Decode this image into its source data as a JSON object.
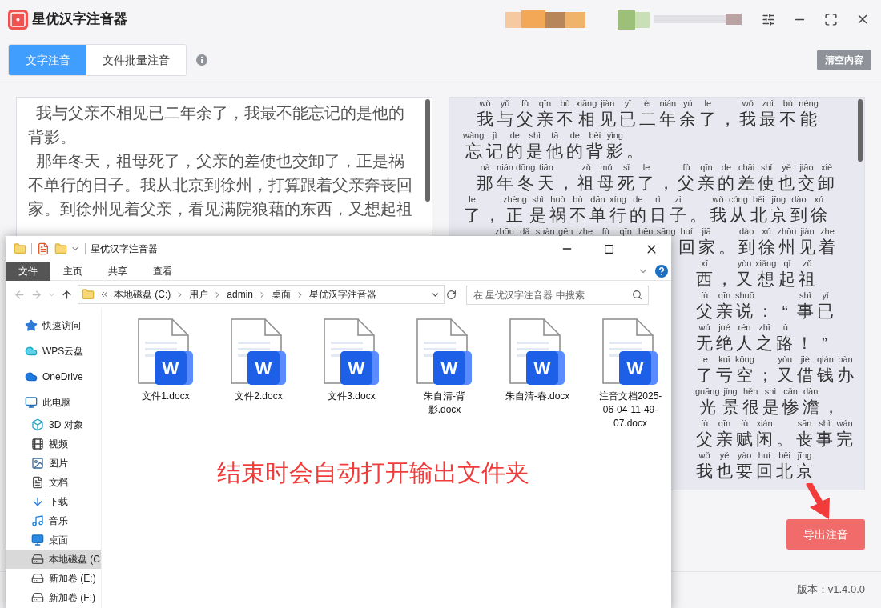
{
  "app": {
    "title": "星优汉字注音器",
    "tabs": [
      {
        "label": "文字注音",
        "selected": true
      },
      {
        "label": "文件批量注音",
        "selected": false
      }
    ],
    "clear_button": "清空内容",
    "input_paragraphs": [
      "我与父亲不相见已二年余了，我最不能忘记的是他的背影。",
      "那年冬天，祖母死了，父亲的差使也交卸了，正是祸不单行的日子。我从北京到徐州，打算跟着父亲奔丧回家。到徐州见着父亲，看见满院狼藉的东西，又想起祖"
    ],
    "pinyin_rows": [
      {
        "kind": "first",
        "tokens": [
          {
            "pinyin": "wǒ",
            "char": "我"
          },
          {
            "pinyin": "yǔ",
            "char": "与"
          },
          {
            "pinyin": "fù",
            "char": "父"
          },
          {
            "pinyin": "qīn",
            "char": "亲"
          },
          {
            "pinyin": "bù",
            "char": "不"
          },
          {
            "pinyin": "xiāng",
            "char": "相"
          },
          {
            "pinyin": "jiàn",
            "char": "见"
          },
          {
            "pinyin": "yǐ",
            "char": "已"
          },
          {
            "pinyin": "èr",
            "char": "二"
          },
          {
            "pinyin": "nián",
            "char": "年"
          },
          {
            "pinyin": "yú",
            "char": "余"
          },
          {
            "pinyin": "le",
            "char": "了"
          },
          {
            "char": "，"
          },
          {
            "pinyin": "wǒ",
            "char": "我"
          },
          {
            "pinyin": "zuì",
            "char": "最"
          },
          {
            "pinyin": "bù",
            "char": "不"
          },
          {
            "pinyin": "néng",
            "char": "能"
          }
        ]
      },
      {
        "kind": "line",
        "tokens": [
          {
            "pinyin": "wàng",
            "char": "忘"
          },
          {
            "pinyin": "jì",
            "char": "记"
          },
          {
            "pinyin": "de",
            "char": "的"
          },
          {
            "pinyin": "shì",
            "char": "是"
          },
          {
            "pinyin": "tā",
            "char": "他"
          },
          {
            "pinyin": "de",
            "char": "的"
          },
          {
            "pinyin": "bèi",
            "char": "背"
          },
          {
            "pinyin": "yǐng",
            "char": "影"
          },
          {
            "char": "。"
          }
        ]
      },
      {
        "kind": "first",
        "tokens": [
          {
            "pinyin": "nà",
            "char": "那"
          },
          {
            "pinyin": "nián",
            "char": "年"
          },
          {
            "pinyin": "dōng",
            "char": "冬"
          },
          {
            "pinyin": "tiān",
            "char": "天"
          },
          {
            "char": "，"
          },
          {
            "pinyin": "zǔ",
            "char": "祖"
          },
          {
            "pinyin": "mǔ",
            "char": "母"
          },
          {
            "pinyin": "sǐ",
            "char": "死"
          },
          {
            "pinyin": "le",
            "char": "了"
          },
          {
            "char": "，"
          },
          {
            "pinyin": "fù",
            "char": "父"
          },
          {
            "pinyin": "qīn",
            "char": "亲"
          },
          {
            "pinyin": "de",
            "char": "的"
          },
          {
            "pinyin": "chāi",
            "char": "差"
          },
          {
            "pinyin": "shǐ",
            "char": "使"
          },
          {
            "pinyin": "yě",
            "char": "也"
          },
          {
            "pinyin": "jiāo",
            "char": "交"
          },
          {
            "pinyin": "xiè",
            "char": "卸"
          }
        ]
      },
      {
        "kind": "line",
        "tokens": [
          {
            "pinyin": "le",
            "char": "了"
          },
          {
            "char": "，"
          },
          {
            "pinyin": "zhèng",
            "char": "正"
          },
          {
            "pinyin": "shì",
            "char": "是"
          },
          {
            "pinyin": "huò",
            "char": "祸"
          },
          {
            "pinyin": "bù",
            "char": "不"
          },
          {
            "pinyin": "dān",
            "char": "单"
          },
          {
            "pinyin": "xíng",
            "char": "行"
          },
          {
            "pinyin": "de",
            "char": "的"
          },
          {
            "pinyin": "rì",
            "char": "日"
          },
          {
            "pinyin": "zi",
            "char": "子"
          },
          {
            "char": "。"
          },
          {
            "pinyin": "wǒ",
            "char": "我"
          },
          {
            "pinyin": "cóng",
            "char": "从"
          },
          {
            "pinyin": "běi",
            "char": "北"
          },
          {
            "pinyin": "jīng",
            "char": "京"
          },
          {
            "pinyin": "dào",
            "char": "到"
          },
          {
            "pinyin": "xú",
            "char": "徐"
          }
        ]
      },
      {
        "kind": "partial",
        "tokens": [
          {
            "pinyin": "zhōu"
          },
          {
            "pinyin": "dǎ"
          },
          {
            "pinyin": "suàn"
          },
          {
            "pinyin": "gēn"
          },
          {
            "pinyin": "zhe"
          },
          {
            "pinyin": "fù"
          },
          {
            "pinyin": "qīn"
          },
          {
            "pinyin": "bēn"
          },
          {
            "pinyin": "sāng"
          },
          {
            "pinyin": "huí",
            "char": "回"
          },
          {
            "pinyin": "jiā",
            "char": "家"
          },
          {
            "char": "。"
          },
          {
            "pinyin": "dào",
            "char": "到"
          },
          {
            "pinyin": "xú",
            "char": "徐"
          },
          {
            "pinyin": "zhōu",
            "char": "州"
          },
          {
            "pinyin": "jiàn",
            "char": "见"
          },
          {
            "pinyin": "zhe",
            "char": "着"
          }
        ]
      },
      {
        "kind": "clipped",
        "tokens": [
          {
            "pinyin": "xī",
            "char": "西"
          },
          {
            "char": "，"
          },
          {
            "pinyin": "yòu",
            "char": "又"
          },
          {
            "pinyin": "xiǎng",
            "char": "想"
          },
          {
            "pinyin": "qǐ",
            "char": "起"
          },
          {
            "pinyin": "zǔ",
            "char": "祖"
          }
        ]
      },
      {
        "kind": "clipped",
        "tokens": [
          {
            "pinyin": "fù",
            "char": "父"
          },
          {
            "pinyin": "qīn",
            "char": "亲"
          },
          {
            "pinyin": "shuō",
            "char": "说"
          },
          {
            "char": "："
          },
          {
            "char": "“"
          },
          {
            "pinyin": "shì",
            "char": "事"
          },
          {
            "pinyin": "yǐ",
            "char": "已"
          }
        ]
      },
      {
        "kind": "clipped",
        "tokens": [
          {
            "pinyin": "wú",
            "char": "无"
          },
          {
            "pinyin": "jué",
            "char": "绝"
          },
          {
            "pinyin": "rén",
            "char": "人"
          },
          {
            "pinyin": "zhī",
            "char": "之"
          },
          {
            "pinyin": "lù",
            "char": "路"
          },
          {
            "char": "！"
          },
          {
            "char": "”"
          }
        ]
      },
      {
        "kind": "clipped",
        "tokens": [
          {
            "pinyin": "le",
            "char": "了"
          },
          {
            "pinyin": "kuī",
            "char": "亏"
          },
          {
            "pinyin": "kōng",
            "char": "空"
          },
          {
            "char": "；"
          },
          {
            "pinyin": "yòu",
            "char": "又"
          },
          {
            "pinyin": "jiè",
            "char": "借"
          },
          {
            "pinyin": "qián",
            "char": "钱"
          },
          {
            "pinyin": "bàn",
            "char": "办"
          }
        ]
      },
      {
        "kind": "clipped",
        "tokens": [
          {
            "pinyin": "guāng",
            "char": "光"
          },
          {
            "pinyin": "jǐng",
            "char": "景"
          },
          {
            "pinyin": "hěn",
            "char": "很"
          },
          {
            "pinyin": "shì",
            "char": "是"
          },
          {
            "pinyin": "cǎn",
            "char": "惨"
          },
          {
            "pinyin": "dàn",
            "char": "澹"
          },
          {
            "char": "，"
          }
        ]
      },
      {
        "kind": "clipped",
        "tokens": [
          {
            "pinyin": "fù",
            "char": "父"
          },
          {
            "pinyin": "qīn",
            "char": "亲"
          },
          {
            "pinyin": "fù",
            "char": "赋"
          },
          {
            "pinyin": "xián",
            "char": "闲"
          },
          {
            "char": "。"
          },
          {
            "pinyin": "sān",
            "char": "丧"
          },
          {
            "pinyin": "shì",
            "char": "事"
          },
          {
            "pinyin": "wán",
            "char": "完"
          }
        ]
      },
      {
        "kind": "clipped",
        "tokens": [
          {
            "pinyin": "wǒ",
            "char": "我"
          },
          {
            "pinyin": "yě",
            "char": "也"
          },
          {
            "pinyin": "yào",
            "char": "要"
          },
          {
            "pinyin": "huí",
            "char": "回"
          },
          {
            "pinyin": "běi",
            "char": "北"
          },
          {
            "pinyin": "jīng",
            "char": "京"
          }
        ]
      }
    ],
    "export_button": "导出注音",
    "version": "版本：v1.4.0.0"
  },
  "explorer": {
    "title": "星优汉字注音器",
    "ribbon_tabs": [
      {
        "label": "文件",
        "selected": true
      },
      {
        "label": "主页",
        "selected": false
      },
      {
        "label": "共享",
        "selected": false
      },
      {
        "label": "查看",
        "selected": false
      }
    ],
    "path": [
      "本地磁盘 (C:)",
      "用户",
      "admin",
      "桌面",
      "星优汉字注音器"
    ],
    "search_placeholder": "在 星优汉字注音器 中搜索",
    "sidebar": [
      {
        "label": "快速访问",
        "kind": "quick",
        "selected": false
      },
      {
        "label": "WPS云盘",
        "kind": "wps",
        "selected": false
      },
      {
        "label": "OneDrive",
        "kind": "onedrive",
        "selected": false
      },
      {
        "label": "此电脑",
        "kind": "pc",
        "selected": false,
        "children": [
          {
            "label": "3D 对象",
            "kind": "objects",
            "selected": false
          },
          {
            "label": "视频",
            "kind": "videos",
            "selected": false
          },
          {
            "label": "图片",
            "kind": "pictures",
            "selected": false
          },
          {
            "label": "文档",
            "kind": "documents",
            "selected": false
          },
          {
            "label": "下载",
            "kind": "downloads",
            "selected": false
          },
          {
            "label": "音乐",
            "kind": "music",
            "selected": false
          },
          {
            "label": "桌面",
            "kind": "desktop",
            "selected": false
          },
          {
            "label": "本地磁盘 (C",
            "kind": "system",
            "selected": true
          },
          {
            "label": "新加卷 (E:)",
            "kind": "drive",
            "selected": false
          },
          {
            "label": "新加卷 (F:)",
            "kind": "drive",
            "selected": false
          }
        ]
      }
    ],
    "files": [
      {
        "name": "文件1.docx",
        "badge": "W"
      },
      {
        "name": "文件2.docx",
        "badge": "W"
      },
      {
        "name": "文件3.docx",
        "badge": "W"
      },
      {
        "name": "朱自清-背影.docx",
        "badge": "W"
      },
      {
        "name": "朱自清-春.docx",
        "badge": "W"
      },
      {
        "name": "注音文档2025-06-04-11-49-07.docx",
        "badge": "W"
      }
    ]
  },
  "annotation": {
    "caption": "结束时会自动打开输出文件夹"
  }
}
